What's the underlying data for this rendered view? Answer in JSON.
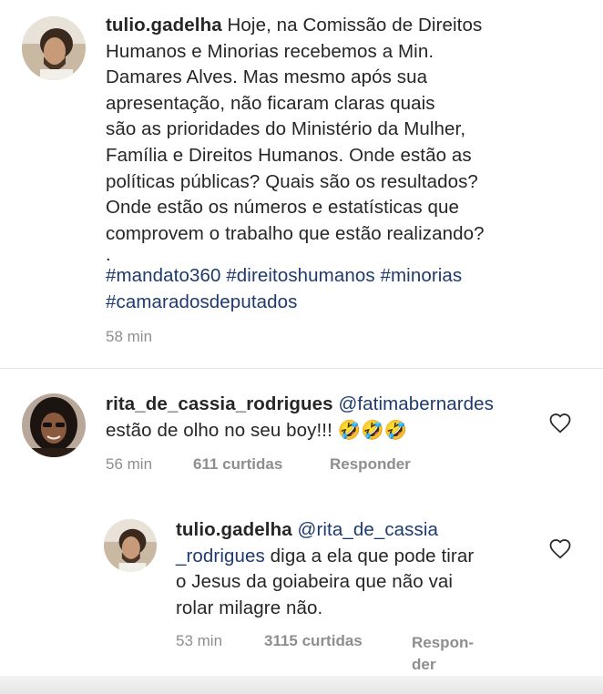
{
  "post": {
    "username": "tulio.gadelha",
    "lines": [
      "Hoje, na Comissão de Direitos",
      "Humanos e Minorias recebemos a Min.",
      "Damares Alves. Mas mesmo após sua",
      "apresentação, não ficaram claras quais",
      "são as prioridades do Ministério da Mulher,",
      "Família e Direitos Humanos. Onde estão as",
      "políticas públicas? Quais são os resultados?",
      "Onde estão os números e estatísticas que",
      "comprovem o trabalho que estão realizando?",
      "."
    ],
    "hashtags": [
      "#mandato360",
      "#direitoshumanos",
      "#minorias",
      "#camaradosdeputados"
    ],
    "time": "58 min"
  },
  "comments": [
    {
      "username": "rita_de_cassia_rodrigues",
      "mention": "@fatimabernardes",
      "text": "estão de olho no seu boy!!!",
      "emoji": "🤣🤣🤣",
      "time": "56 min",
      "likes": "611 curtidas",
      "reply_label": "Responder"
    },
    {
      "username": "tulio.gadelha",
      "mention_part1": "@rita_de_cassia",
      "mention_part2": "_rodrigues",
      "line1_rest": "diga a ela que pode tirar",
      "line2": "o Jesus da goiabeira que não vai",
      "line3": "rolar milagre não.",
      "time": "53 min",
      "likes": "3115 curtidas",
      "reply_label_line1": "Respon-",
      "reply_label_line2": "der"
    }
  ],
  "colors": {
    "text": "#262626",
    "link": "#1e3a6d",
    "meta": "#8e8e8e"
  },
  "icons": [
    "heart-icon"
  ]
}
